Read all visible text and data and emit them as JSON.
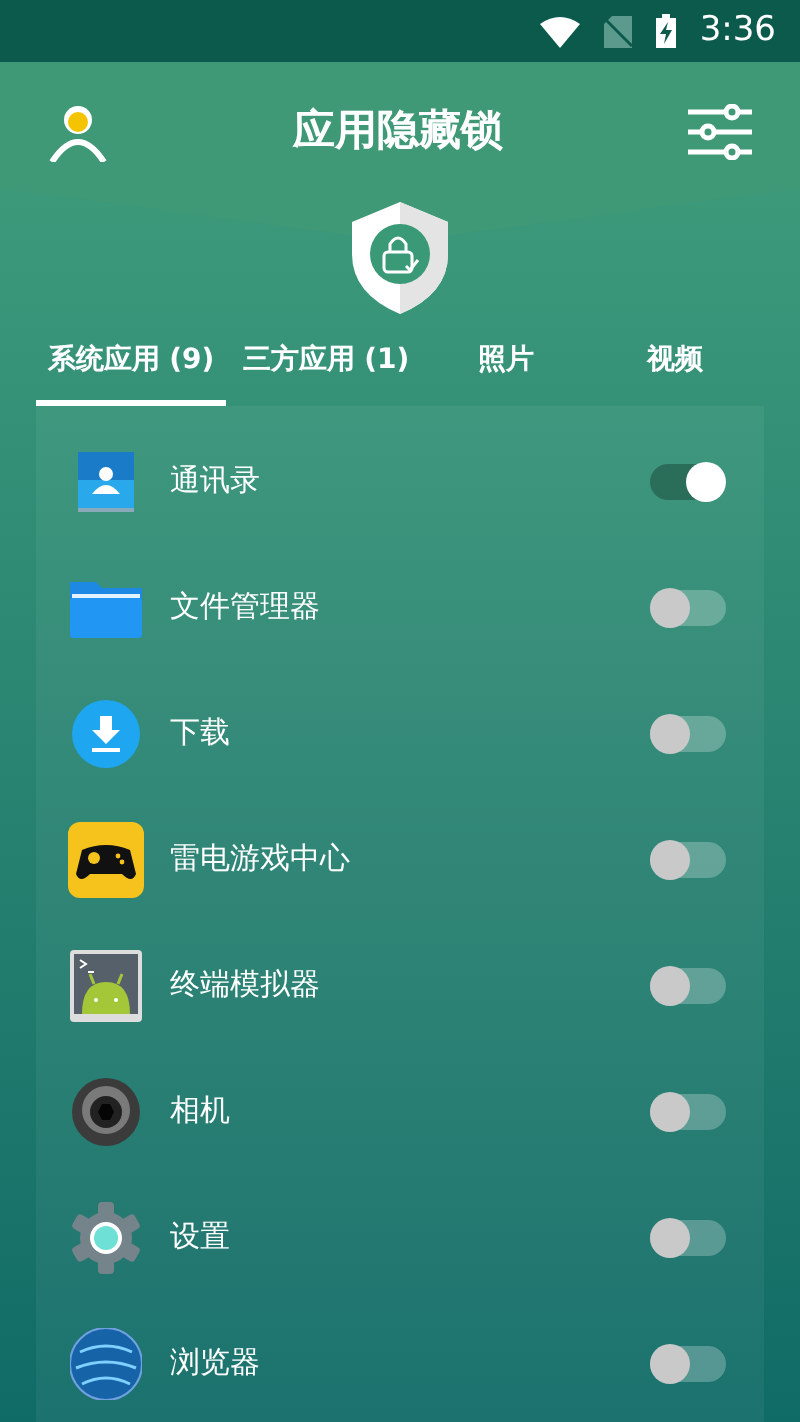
{
  "status_bar": {
    "time": "3:36"
  },
  "header": {
    "title": "应用隐藏锁"
  },
  "tabs": [
    {
      "label": "系统应用 (9)",
      "selected": true
    },
    {
      "label": "三方应用 (1)",
      "selected": false
    },
    {
      "label": "照片",
      "selected": false
    },
    {
      "label": "视频",
      "selected": false
    }
  ],
  "apps": [
    {
      "name": "通讯录",
      "kind": "contacts",
      "on": true
    },
    {
      "name": "文件管理器",
      "kind": "folder",
      "on": false
    },
    {
      "name": "下载",
      "kind": "download",
      "on": false
    },
    {
      "name": "雷电游戏中心",
      "kind": "gamepad",
      "on": false
    },
    {
      "name": "终端模拟器",
      "kind": "terminal",
      "on": false
    },
    {
      "name": "相机",
      "kind": "camera",
      "on": false
    },
    {
      "name": "设置",
      "kind": "gear",
      "on": false
    },
    {
      "name": "浏览器",
      "kind": "globe",
      "on": false
    }
  ]
}
